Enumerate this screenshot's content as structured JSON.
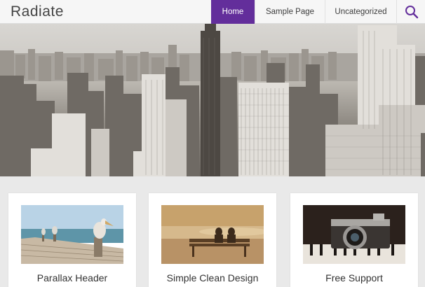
{
  "site": {
    "logo": "Radiate"
  },
  "nav": {
    "items": [
      {
        "label": "Home",
        "active": true
      },
      {
        "label": "Sample Page",
        "active": false
      },
      {
        "label": "Uncategorized",
        "active": false
      }
    ],
    "search_icon": "search-icon"
  },
  "colors": {
    "accent": "#632e9b",
    "background": "#e9e9e9"
  },
  "features": [
    {
      "title": "Parallax Header"
    },
    {
      "title": "Simple Clean Design"
    },
    {
      "title": "Free Support"
    }
  ]
}
